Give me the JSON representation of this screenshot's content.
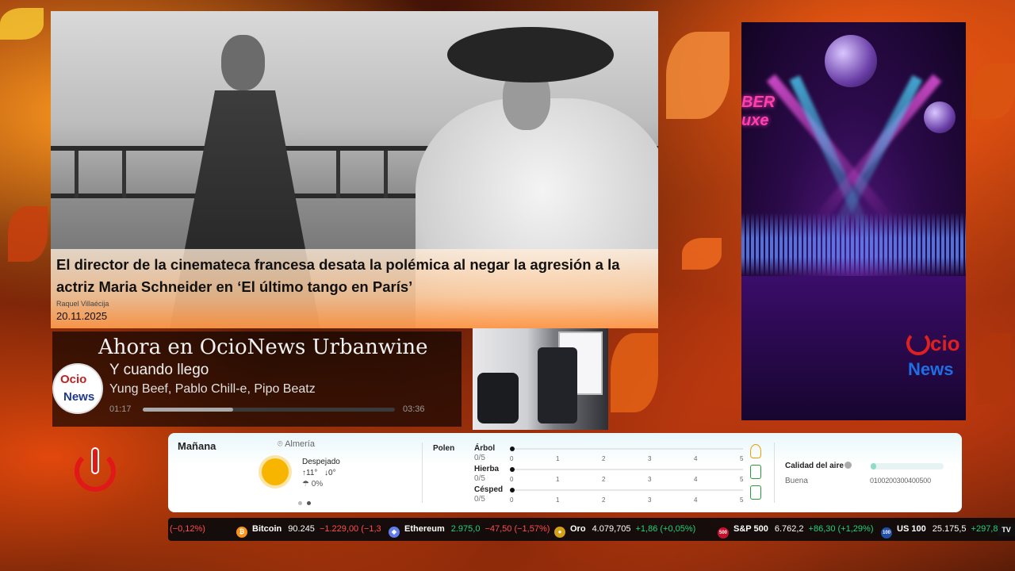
{
  "colors": {
    "brand_red": "#e01818",
    "brand_blue": "#1e6ee6",
    "positive": "#22d27a",
    "negative": "#ff4d4d"
  },
  "news": {
    "title": "El director de la cinemateca francesa desata la polémica al negar la agresión a la actriz Maria Schneider en ‘El último tango en París’",
    "author": "Raquel Villaécija",
    "date": "20.11.2025"
  },
  "player": {
    "header": "Ahora en OcioNews Urbanwine",
    "logo_top": "Ocio",
    "logo_bottom": "News",
    "track_title": "Y cuando llego",
    "track_artist": "Yung Beef, Pablo Chill-e, Pipo Beatz",
    "time_elapsed": "01:17",
    "time_total": "03:36",
    "progress_fraction": 0.36
  },
  "promo": {
    "brand_partial": "BER",
    "brand_partial2": "uxe",
    "logo_top": "cio",
    "logo_bottom": "News"
  },
  "weather": {
    "day": "Mañana",
    "location": "Almería",
    "location_icon": "pin-icon",
    "condition": "Despejado",
    "condition_icon": "sun-icon",
    "high": "↑11°",
    "low": "↓0°",
    "rain": "☂ 0%",
    "carousel_active": 2,
    "pollen": {
      "label": "Polen",
      "rows": [
        {
          "name": "Árbol",
          "score": "0/5",
          "icon": "tree-icon"
        },
        {
          "name": "Hierba",
          "score": "0/5",
          "icon": "grass-icon"
        },
        {
          "name": "Césped",
          "score": "0/5",
          "icon": "lawn-icon"
        }
      ],
      "scale": [
        "0",
        "1",
        "2",
        "3",
        "4",
        "5"
      ]
    },
    "air_quality": {
      "label": "Calidad del aire",
      "value": "Buena",
      "scale": "0100200300400500",
      "fraction": 0.08
    }
  },
  "ticker": [
    {
      "name": "",
      "value": "",
      "change": "(−0,12%)",
      "direction": "neg",
      "icon": "",
      "color": "#000"
    },
    {
      "name": "Bitcoin",
      "value": "90.245",
      "change": "−1.229,00 (−1,3",
      "direction": "neg",
      "icon": "bitcoin-icon",
      "color": "#f7931a",
      "glyph": "₿"
    },
    {
      "name": "Ethereum",
      "value": "2.975,0",
      "change": "−47,50 (−1,57%)",
      "direction": "neg",
      "icon": "ethereum-icon",
      "color": "#627eea",
      "glyph": "◆"
    },
    {
      "name": "Oro",
      "value": "4.079,705",
      "change": "+1,86 (+0,05%)",
      "direction": "pos",
      "icon": "gold-icon",
      "color": "#d4a017",
      "glyph": "●"
    },
    {
      "name": "S&P 500",
      "value": "6.762,2",
      "change": "+86,30 (+1,29%)",
      "direction": "pos",
      "icon": "sp500-icon",
      "color": "#c8102e",
      "glyph": "500"
    },
    {
      "name": "US 100",
      "value": "25.175,5",
      "change": "+297,80",
      "direction": "pos",
      "icon": "us100-icon",
      "color": "#1f4fa8",
      "glyph": "100"
    }
  ],
  "ticker_brand": "TV"
}
